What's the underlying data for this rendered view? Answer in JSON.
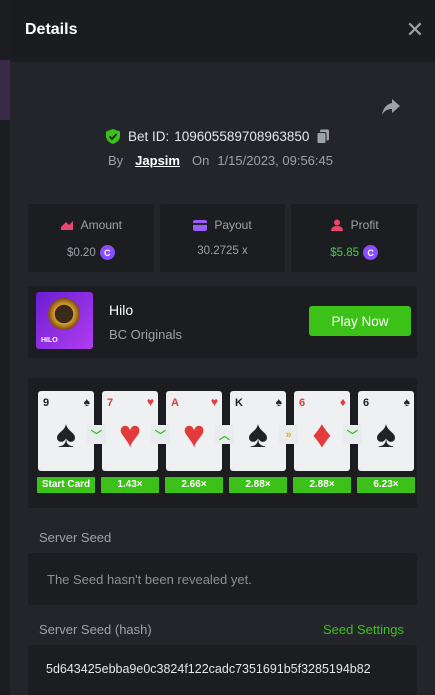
{
  "header": {
    "title": "Details",
    "close_icon": "close-icon"
  },
  "bet": {
    "bet_id_label": "Bet ID:",
    "bet_id": "109605589708963850",
    "by_label": "By",
    "user": "Japsim",
    "on_label": "On",
    "datetime": "1/15/2023, 09:56:45"
  },
  "stats": {
    "amount": {
      "label": "Amount",
      "value": "$0.20",
      "coin": "C"
    },
    "payout": {
      "label": "Payout",
      "value": "30.2725 x"
    },
    "profit": {
      "label": "Profit",
      "value": "$5.85",
      "coin": "C"
    }
  },
  "game": {
    "name": "Hilo",
    "provider": "BC Originals",
    "thumb_tag": "HILO",
    "play_label": "Play Now"
  },
  "cards": [
    {
      "rank": "9",
      "suit": "♠",
      "color": "black",
      "mult": "Start Card"
    },
    {
      "rank": "7",
      "suit": "♥",
      "color": "red",
      "mult": "1.43×"
    },
    {
      "rank": "A",
      "suit": "♥",
      "color": "red",
      "mult": "2.66×"
    },
    {
      "rank": "K",
      "suit": "♠",
      "color": "black",
      "mult": "2.88×"
    },
    {
      "rank": "6",
      "suit": "♦",
      "color": "red",
      "mult": "2.88×"
    },
    {
      "rank": "6",
      "suit": "♠",
      "color": "black",
      "mult": "6.23×"
    }
  ],
  "arrows": [
    {
      "glyph": "﹀",
      "kind": "lower",
      "color": "#3bc117"
    },
    {
      "glyph": "﹀",
      "kind": "lower",
      "color": "#3bc117"
    },
    {
      "glyph": "︿",
      "kind": "higher",
      "color": "#3bc117"
    },
    {
      "glyph": "»",
      "kind": "skip",
      "color": "#e0b020"
    },
    {
      "glyph": "﹀",
      "kind": "lower",
      "color": "#3bc117"
    }
  ],
  "seeds": {
    "server_seed_label": "Server Seed",
    "server_seed_value": "The Seed hasn't been revealed yet.",
    "hash_label": "Server Seed (hash)",
    "seed_settings_label": "Seed Settings",
    "hash_value": "5d643425ebba9e0c3824f122cadc7351691b5f3285194b82"
  },
  "colors": {
    "accent": "#3bc117",
    "coin": "#8a4dff"
  }
}
